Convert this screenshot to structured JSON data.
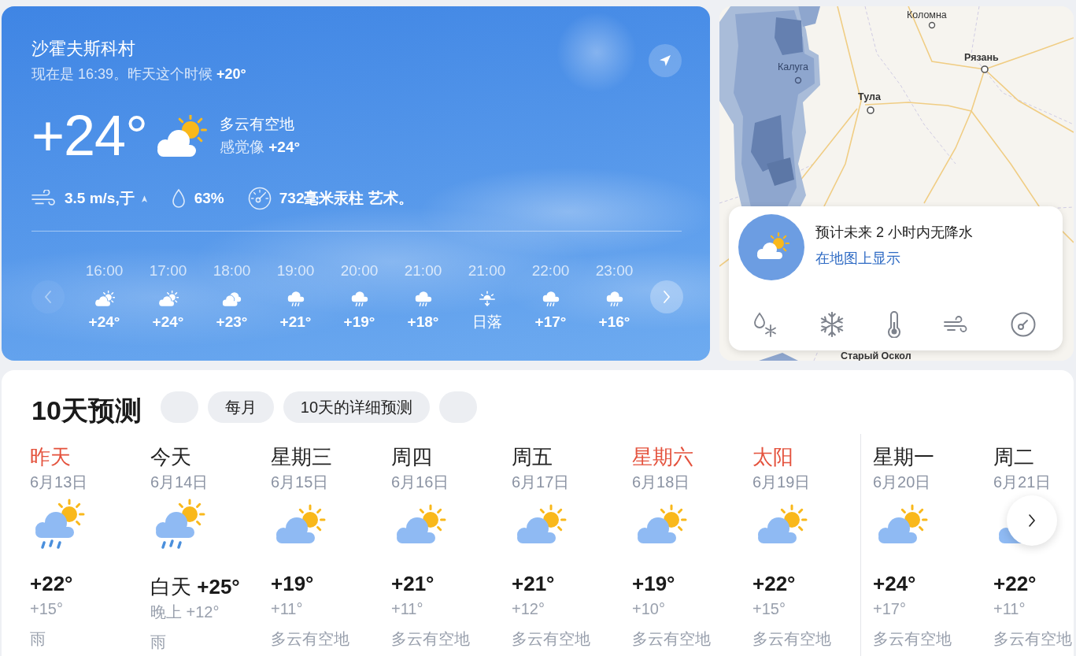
{
  "location": {
    "city": "沙霍夫斯科村",
    "subtitle": "现在是 16:39。昨天这个时候 **+20°**"
  },
  "current": {
    "temperature": "+24°",
    "condition": "多云有空地",
    "feels_like": "感觉像 **+24°**",
    "wind": "3.5 m/s,于",
    "humidity": "63%",
    "pressure": "732毫米汞柱 艺术。"
  },
  "hourly": {
    "prev_disabled": true,
    "next_disabled": false,
    "items": [
      {
        "time": "16:00",
        "kind": "partlycloudy",
        "value": "+24°"
      },
      {
        "time": "17:00",
        "kind": "partlycloudy",
        "value": "+24°"
      },
      {
        "time": "18:00",
        "kind": "cloudy",
        "value": "+23°"
      },
      {
        "time": "19:00",
        "kind": "rain",
        "value": "+21°"
      },
      {
        "time": "20:00",
        "kind": "rain",
        "value": "+19°"
      },
      {
        "time": "21:00",
        "kind": "rain",
        "value": "+18°"
      },
      {
        "time": "21:00",
        "kind": "sunset",
        "value": "日落"
      },
      {
        "time": "22:00",
        "kind": "rain",
        "value": "+17°"
      },
      {
        "time": "23:00",
        "kind": "rain",
        "value": "+16°"
      }
    ]
  },
  "map": {
    "places": [
      "Коломна",
      "Рязань",
      "Калуга",
      "Тула",
      "Старый Оскол"
    ],
    "nowcast": "预计未来 2 小时内无降水",
    "link": "在地图上显示"
  },
  "forecast": {
    "title": "10天预测",
    "tabs": [
      {
        "label": "每月",
        "selected": false
      },
      {
        "label": "10天的详细预测",
        "selected": false
      }
    ],
    "weeks": [
      {
        "days": [
          {
            "name": "昨天",
            "holiday": true,
            "date": "6月13日",
            "rain": true,
            "kind": "day",
            "day_temp": "+22°",
            "night_temp": "+15°",
            "condition": "雨"
          },
          {
            "name": "今天",
            "holiday": false,
            "date": "6月14日",
            "rain": true,
            "kind": "today",
            "day_temp": "白天 **+25°**",
            "night_temp": "晚上 +12°",
            "condition": "雨"
          },
          {
            "name": "星期三",
            "holiday": false,
            "date": "6月15日",
            "rain": false,
            "kind": "day",
            "day_temp": "+19°",
            "night_temp": "+11°",
            "condition": "多云有空地"
          },
          {
            "name": "周四",
            "holiday": false,
            "date": "6月16日",
            "rain": false,
            "kind": "day",
            "day_temp": "+21°",
            "night_temp": "+11°",
            "condition": "多云有空地"
          },
          {
            "name": "周五",
            "holiday": false,
            "date": "6月17日",
            "rain": false,
            "kind": "day",
            "day_temp": "+21°",
            "night_temp": "+12°",
            "condition": "多云有空地"
          },
          {
            "name": "星期六",
            "holiday": true,
            "date": "6月18日",
            "rain": false,
            "kind": "day",
            "day_temp": "+19°",
            "night_temp": "+10°",
            "condition": "多云有空地"
          },
          {
            "name": "太阳",
            "holiday": true,
            "date": "6月19日",
            "rain": false,
            "kind": "day",
            "day_temp": "+22°",
            "night_temp": "+15°",
            "condition": "多云有空地"
          }
        ]
      },
      {
        "days": [
          {
            "name": "星期一",
            "holiday": false,
            "date": "6月20日",
            "rain": false,
            "kind": "day",
            "day_temp": "+24°",
            "night_temp": "+17°",
            "condition": "多云有空地"
          },
          {
            "name": "周二",
            "holiday": false,
            "date": "6月21日",
            "rain": false,
            "kind": "day",
            "day_temp": "+22°",
            "night_temp": "+11°",
            "condition": "多云有空地"
          }
        ]
      }
    ]
  }
}
